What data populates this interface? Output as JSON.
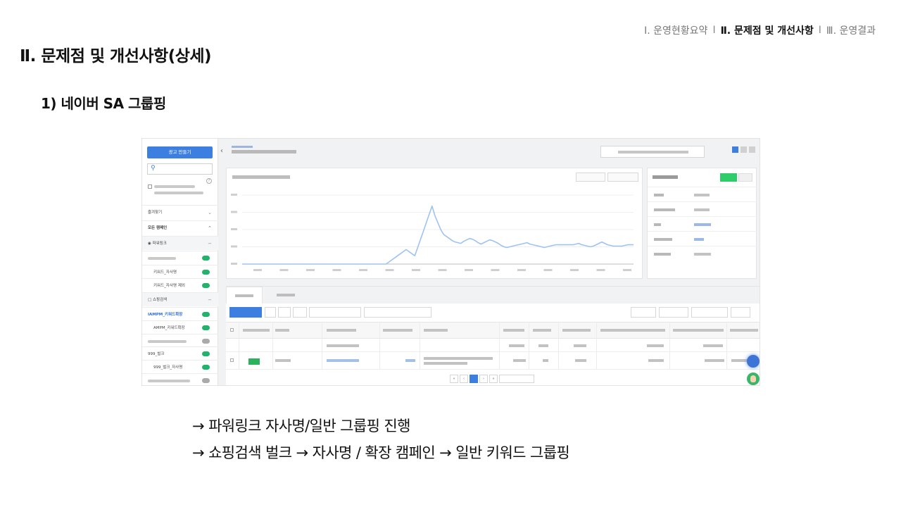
{
  "topnav": {
    "item1": "Ⅰ. 운영현황요약",
    "item2": "Ⅱ. 문제점 및 개선사항",
    "item3": "Ⅲ. 운영결과"
  },
  "slide": {
    "title": "Ⅱ. 문제점 및 개선사항(상세)",
    "subtitle": "1) 네이버 SA 그룹핑"
  },
  "screenshot": {
    "create_button": "광고 만들기",
    "sidebar_labels": {
      "favorites": "즐겨찾기",
      "all_campaigns": "모든 캠페인",
      "powerlink": "파워링크",
      "shopping": "쇼핑검색"
    },
    "sidebar_items": [
      {
        "label": "키워드_자사명",
        "status": "on"
      },
      {
        "label": "키워드_자사명 제외",
        "status": "on"
      },
      {
        "label": "IAMPM_키워드확장",
        "status": "on",
        "selected": true
      },
      {
        "label": "AMPM_키워드확장",
        "status": "on"
      },
      {
        "label": "999_벌크",
        "status": "on"
      },
      {
        "label": "999_벌크_자사명",
        "status": "on"
      }
    ],
    "chart_series": [
      0,
      0,
      0,
      0,
      0,
      0,
      0,
      0,
      0,
      0,
      0,
      0,
      0,
      0,
      0,
      0,
      0,
      0,
      0,
      0,
      0,
      0,
      0,
      0,
      0,
      0,
      0,
      0,
      0,
      0,
      0,
      0,
      0,
      0,
      0,
      0,
      0,
      0,
      0,
      0,
      0,
      0,
      0,
      0,
      0,
      0,
      0,
      0,
      0,
      0,
      0,
      300,
      600,
      900,
      1200,
      1500,
      1800,
      2100,
      1800,
      1500,
      1200,
      2400,
      3600,
      4800,
      6000,
      7200,
      8400,
      7000,
      6000,
      5000,
      4300,
      4000,
      3700,
      3400,
      3200,
      3100,
      3000,
      3300,
      3500,
      3700,
      3600,
      3400,
      3100,
      2900,
      3100,
      3300,
      3500,
      3400,
      3200,
      3000,
      2700,
      2500,
      2400,
      2500,
      2600,
      2700,
      2800,
      2900,
      3000,
      3100,
      2900,
      2800,
      2700,
      2600,
      2500,
      2400,
      2500,
      2600,
      2700,
      2800,
      2800,
      2800,
      2800,
      2800,
      2800,
      2800,
      2900,
      3000,
      2800,
      2700,
      2600,
      2500,
      2600,
      2800,
      3000,
      3200,
      3000,
      2800,
      2700,
      2600,
      2600,
      2600,
      2600,
      2700,
      2800,
      2800,
      2800
    ]
  },
  "notes": {
    "line1": "→ 파워링크 자사명/일반 그룹핑 진행",
    "line2": "→ 쇼핑검색 벌크 → 자사명 / 확장 캠페인 → 일반 키워드 그룹핑"
  },
  "colors": {
    "accent_blue": "#3d7fe0",
    "toggle_green": "#22b36b",
    "chart_line": "#9ec3f0"
  }
}
